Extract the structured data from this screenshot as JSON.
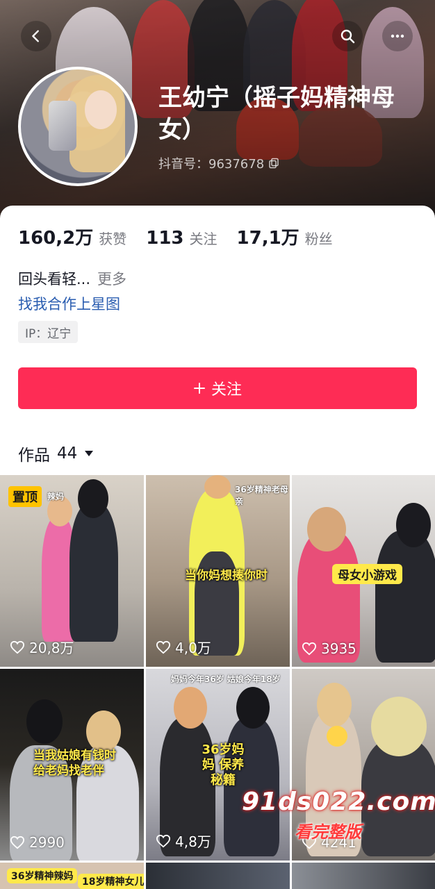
{
  "profile": {
    "name": "王幼宁（摇子妈精神母女）",
    "douyin_id": "抖音号：9637678"
  },
  "stats": [
    {
      "value": "160,2万",
      "label": "获赞"
    },
    {
      "value": "113",
      "label": "关注"
    },
    {
      "value": "17,1万",
      "label": "粉丝"
    }
  ],
  "bio": {
    "text": "回头看轻...",
    "more": "更多",
    "link": "找我合作上星图",
    "ip": "IP：辽宁"
  },
  "follow": {
    "label": "关注",
    "color": "#fe2c55"
  },
  "works": {
    "title": "作品",
    "count": "44"
  },
  "videos": [
    {
      "likes": "20,8万",
      "badge": "置顶",
      "caption": "",
      "tag": "辣妈"
    },
    {
      "likes": "4,0万",
      "caption": "当你妈想揍你时",
      "tag": "36岁精神老母亲"
    },
    {
      "likes": "3935",
      "caption": "母女小游戏",
      "tag": ""
    },
    {
      "likes": "2990",
      "caption": "当我姑娘有钱时 给老妈找老伴",
      "tag": ""
    },
    {
      "likes": "4,8万",
      "caption": "36岁妈妈 保养秘籍",
      "tag": "妈妈今年36岁   姑娘今年18岁"
    },
    {
      "likes": "4241",
      "caption": "",
      "tag": ""
    }
  ],
  "bottom_row_tags": [
    "36岁精神辣妈",
    "18岁精神女儿"
  ],
  "watermark": {
    "site": "91ds022.com",
    "slogan": "看完整版"
  }
}
